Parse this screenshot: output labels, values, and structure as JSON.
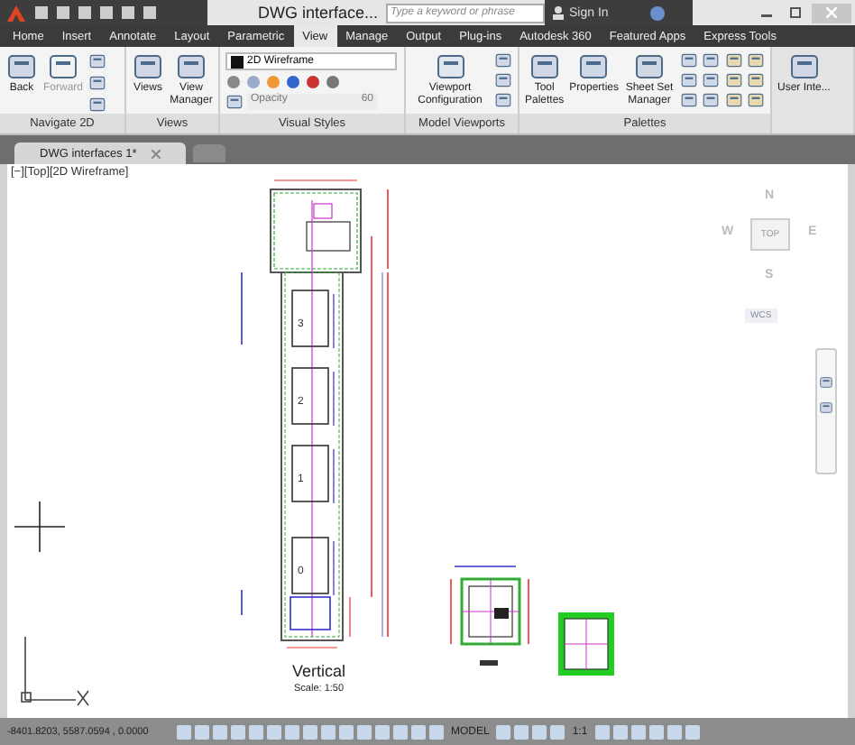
{
  "window": {
    "title": "DWG interface...",
    "search": {
      "placeholder": "Type a keyword or phrase"
    },
    "sign_in": "Sign In"
  },
  "ribbon_tabs": [
    {
      "label": "Home",
      "selected": false
    },
    {
      "label": "Insert",
      "selected": false
    },
    {
      "label": "Annotate",
      "selected": false
    },
    {
      "label": "Layout",
      "selected": false
    },
    {
      "label": "Parametric",
      "selected": false
    },
    {
      "label": "View",
      "selected": true
    },
    {
      "label": "Manage",
      "selected": false
    },
    {
      "label": "Output",
      "selected": false
    },
    {
      "label": "Plug-ins",
      "selected": false
    },
    {
      "label": "Autodesk 360",
      "selected": false
    },
    {
      "label": "Featured Apps",
      "selected": false
    },
    {
      "label": "Express Tools",
      "selected": false
    }
  ],
  "panels": [
    {
      "label": "Navigate 2D",
      "buttons": [
        {
          "label": "Back",
          "disabled": false
        },
        {
          "label": "Forward",
          "disabled": true
        }
      ]
    },
    {
      "label": "Views",
      "buttons": [
        {
          "label": "Views",
          "disabled": false
        },
        {
          "label": "View Manager",
          "disabled": false
        }
      ]
    },
    {
      "label": "Visual Styles",
      "style_dropdown": "2D Wireframe",
      "opacity": {
        "label": "Opacity",
        "value": "60",
        "disabled": true
      }
    },
    {
      "label": "Model Viewports",
      "buttons": [
        {
          "label": "Viewport Configuration",
          "disabled": false
        }
      ]
    },
    {
      "label": "Palettes",
      "buttons": [
        {
          "label": "Tool Palettes",
          "disabled": false
        },
        {
          "label": "Properties",
          "disabled": false
        },
        {
          "label": "Sheet Set Manager",
          "disabled": false
        }
      ]
    },
    {
      "buttons": [
        {
          "label": "User Inte...",
          "disabled": false
        }
      ]
    }
  ],
  "document_tabs": [
    {
      "label": "DWG interfaces 1*",
      "selected": true
    }
  ],
  "viewport": {
    "label": "[−][Top][2D Wireframe]",
    "viewcube": {
      "north": "N",
      "west": "W",
      "face": "TOP",
      "east": "E",
      "south": "S",
      "ucs": "WCS"
    },
    "drawing": {
      "floors": [
        "3",
        "2",
        "1",
        "0"
      ],
      "title": "Vertical",
      "scale": "Scale: 1:50"
    }
  },
  "status_bar": {
    "coordinates": "-8401.8203, 5587.0594 , 0.0000",
    "space": "MODEL",
    "annotation_scale": "1:1"
  }
}
